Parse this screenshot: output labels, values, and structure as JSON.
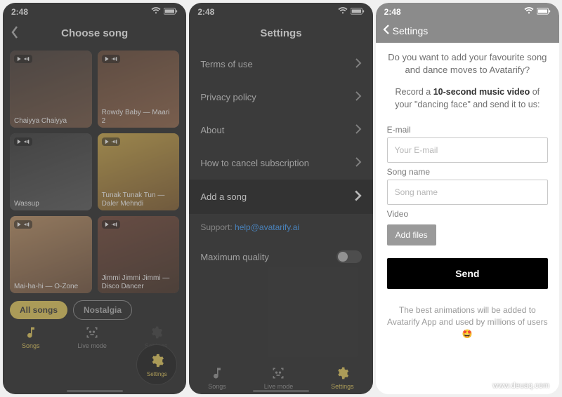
{
  "watermark": "www.deuaq.com",
  "status": {
    "time": "2:48"
  },
  "screen1": {
    "title": "Choose song",
    "songs": [
      {
        "caption": "Chaiyya Chaiyya",
        "bg": "linear-gradient(160deg,#3a2f2a,#6b4a36)"
      },
      {
        "caption": "Rowdy Baby — Maari 2",
        "bg": "linear-gradient(160deg,#5a3a28,#8a5a3c)"
      },
      {
        "caption": "Wassup",
        "bg": "linear-gradient(160deg,#2a2a2a,#505050)"
      },
      {
        "caption": "Tunak Tunak Tun — Daler Mehndi",
        "bg": "linear-gradient(160deg,#c9a23a,#7a521f)"
      },
      {
        "caption": "Mai-ha-hi — O-Zone",
        "bg": "linear-gradient(160deg,#b88a5a,#6a4830)"
      },
      {
        "caption": "Jimmi Jimmi Jimmi — Disco Dancer",
        "bg": "linear-gradient(160deg,#6a3a2a,#3a2418)"
      }
    ],
    "chips": {
      "all": "All songs",
      "nostalgia": "Nostalgia"
    },
    "tabs": {
      "songs": "Songs",
      "live": "Live mode",
      "settings": "Settings"
    },
    "fab": "Settings"
  },
  "screen2": {
    "title": "Settings",
    "items": {
      "terms": "Terms of use",
      "privacy": "Privacy policy",
      "about": "About",
      "cancel": "How to cancel subscription",
      "addsong": "Add a song",
      "maxq": "Maximum quality"
    },
    "support_label": "Support: ",
    "support_link": "help@avatarify.ai",
    "tabs": {
      "songs": "Songs",
      "live": "Live mode",
      "settings": "Settings"
    }
  },
  "screen3": {
    "back": "Settings",
    "intro": "Do you want to add your favourite song and dance moves to Avatarify?",
    "instr_pre": "Record a ",
    "instr_bold": "10-second music video",
    "instr_post": " of your \"dancing face\" and send it to us:",
    "email_label": "E-mail",
    "email_placeholder": "Your E-mail",
    "song_label": "Song name",
    "song_placeholder": "Song name",
    "video_label": "Video",
    "addfiles": "Add files",
    "send": "Send",
    "footnote": "The best animations will be added to Avatarify App and used by millions of users 🤩"
  }
}
